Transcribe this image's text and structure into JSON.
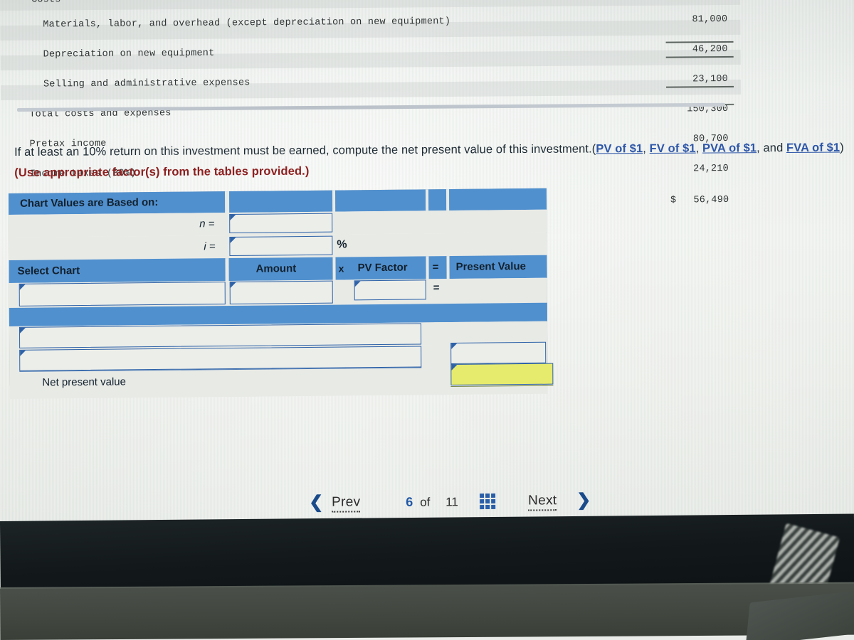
{
  "statement": {
    "partial_header": "Costs",
    "rows": [
      {
        "label": "Materials, labor, and overhead (except depreciation on new equipment)",
        "value": "81,000",
        "indent": 2,
        "currency": "",
        "rule": "none"
      },
      {
        "label": "Depreciation on new equipment",
        "value": "46,200",
        "indent": 2,
        "currency": "",
        "rule": "none"
      },
      {
        "label": "Selling and administrative expenses",
        "value": "23,100",
        "indent": 2,
        "currency": "",
        "rule": "single"
      },
      {
        "label": "Total costs and expenses",
        "value": "150,300",
        "indent": 1,
        "currency": "",
        "rule": "single"
      },
      {
        "label": "Pretax income",
        "value": "80,700",
        "indent": 1,
        "currency": "",
        "rule": "none"
      },
      {
        "label": "Income taxes (30%)",
        "value": "24,210",
        "indent": 1,
        "currency": "",
        "rule": "single"
      },
      {
        "label": "Net income",
        "value": "56,490",
        "indent": 1,
        "currency": "$",
        "rule": "double"
      }
    ]
  },
  "question": {
    "lead": "If at least an 10% return on this investment must be earned, compute the net present value of this investment.",
    "links": [
      "PV of $1",
      "FV of $1",
      "PVA of $1",
      "FVA of $1"
    ],
    "instruction": "(Use appropriate factor(s) from the tables provided.)",
    "open_paren": "(",
    "comma": ", ",
    "and_word": "and ",
    "close_paren": ")"
  },
  "sheet": {
    "title": "Chart Values are Based on:",
    "n_label": "n =",
    "i_label": "i =",
    "percent_label": "%",
    "select_chart_label": "Select Chart",
    "amount_label": "Amount",
    "times_label": "x",
    "pv_factor_label": "PV Factor",
    "equals_label": "=",
    "present_value_label": "Present Value",
    "row_equals": "=",
    "net_present_value_label": "Net present value",
    "values": {
      "n_value": "",
      "i_value": "",
      "select_chart_value": "",
      "amount_value": "",
      "pv_factor_value": "",
      "present_value_value": "",
      "mid_row_a": "",
      "mid_row_b": "",
      "mid_value_b": "",
      "net_present_value_value": ""
    },
    "colors": {
      "header_blue": "#5190ce",
      "input_border": "#2e62a8",
      "answer_yellow": "#e6ea6d",
      "cell_gray": "#e8eae6"
    }
  },
  "nav": {
    "prev_label": "Prev",
    "current_page": "6",
    "of_label": "of",
    "total_pages": "11",
    "next_label": "Next",
    "prev_icon": "chevron-left",
    "next_icon": "chevron-right",
    "grid_icon": "grid-3x3"
  }
}
